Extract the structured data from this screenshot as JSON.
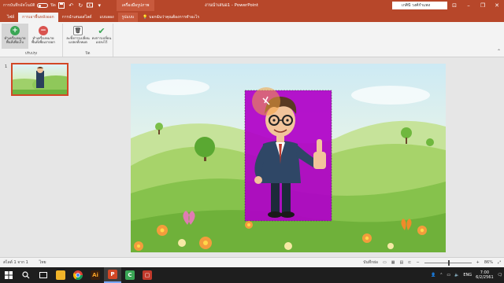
{
  "titlebar": {
    "autosave_label": "การบันทึกอัตโนมัติ",
    "autosave_state": "ปิด",
    "context_label": "เครื่องมือรูปภาพ",
    "doc_title": "งานนำเสนอ1 - PowerPoint",
    "user_name": "เกศินี วงศ์กำแพง"
  },
  "tabs": [
    {
      "label": "ไฟล์"
    },
    {
      "label": "การเอาพื้นหลังออก"
    },
    {
      "label": "การนำเสนอสไลด์"
    },
    {
      "label": "แบบลอง"
    },
    {
      "label": "รูปแบบ"
    }
  ],
  "tell_me": "บอกฉันว่าคุณต้องการทำอะไร",
  "ribbon": {
    "btn_mark_keep": "ทำเครื่องหมาย\nพื้นที่เพื่อเก็บ",
    "btn_mark_remove": "ทำเครื่องหมาย\nพื้นที่เพื่อเอาออก",
    "btn_discard": "ละทิ้งการเปลี่ยน\nแปลงทั้งหมด",
    "btn_keep": "คงการเปลี่ยน\nแปลงไว้",
    "group_refine": "ปรับปรุง",
    "group_close": "ปิด"
  },
  "thumbs": {
    "slide_number": "1"
  },
  "status": {
    "slide_info": "สไลด์ 1 จาก 1",
    "language": "ไทย",
    "notes": "บันทึกย่อ",
    "zoom": "86%"
  },
  "taskbar": {
    "lang": "ENG",
    "time": "7:00",
    "date": "6/2/2561"
  },
  "colors": {
    "ppt_accent": "#b7472a",
    "background_removal_mask": "#b000c8"
  }
}
